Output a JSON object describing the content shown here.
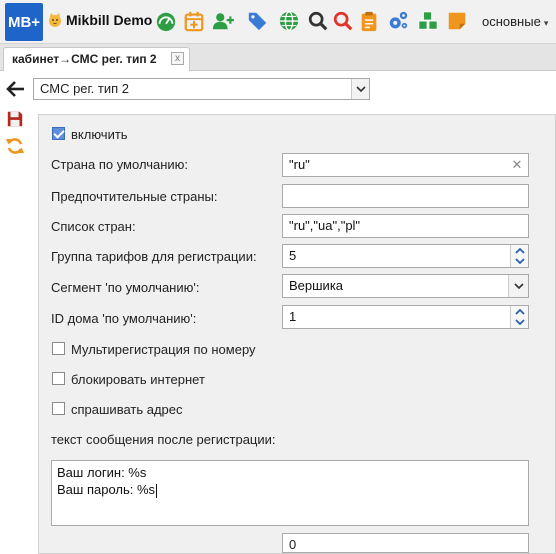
{
  "app": {
    "logo_text": "MB+",
    "brand_name": "Mikbill Demo",
    "menu_label": "основные",
    "accent": "#1f64c8"
  },
  "toolbar_icons": [
    {
      "name": "dashboard-icon",
      "color": "#2e9e44"
    },
    {
      "name": "calendar-add-icon",
      "color": "#f0961e"
    },
    {
      "name": "user-add-icon",
      "color": "#2e9e44"
    },
    {
      "name": "tags-icon",
      "color": "#3a7bd5"
    },
    {
      "name": "globe-icon",
      "color": "#2e9e44"
    },
    {
      "name": "search-icon",
      "color": "#333333"
    },
    {
      "name": "search-red-icon",
      "color": "#e0342a"
    },
    {
      "name": "clipboard-icon",
      "color": "#f0961e"
    },
    {
      "name": "gears-icon",
      "color": "#3a7bd5"
    },
    {
      "name": "cubes-icon",
      "color": "#2e9e44"
    },
    {
      "name": "sticky-note-icon",
      "color": "#f0961e"
    }
  ],
  "tab": {
    "label": "кабинет→СМС рег. тип 2",
    "close": "x"
  },
  "nav": {
    "page_select": "СМС рег. тип 2"
  },
  "form": {
    "enable_label": "включить",
    "enable_checked": true,
    "default_country_label": "Страна по умолчанию:",
    "default_country_value": "\"ru\"",
    "preferred_countries_label": "Предпочтительные страны:",
    "preferred_countries_value": "",
    "country_list_label": "Список стран:",
    "country_list_value": "\"ru\",\"ua\",\"pl\"",
    "tariff_group_label": "Группа тарифов для регистрации:",
    "tariff_group_value": "5",
    "segment_label": "Сегмент 'по умолчанию':",
    "segment_value": "Вершика",
    "house_id_label": "ID дома 'по умолчанию':",
    "house_id_value": "1",
    "multireg_label": "Мультирегистрация по номеру",
    "multireg_checked": false,
    "block_internet_label": "блокировать интернет",
    "block_internet_checked": false,
    "ask_address_label": "спрашивать адрес",
    "ask_address_checked": false,
    "message_label": "текст сообщения после регистрации:",
    "message_line1": "Ваш логин: %s",
    "message_line2": "Ваш пароль: %s",
    "next_field_value": "0"
  }
}
